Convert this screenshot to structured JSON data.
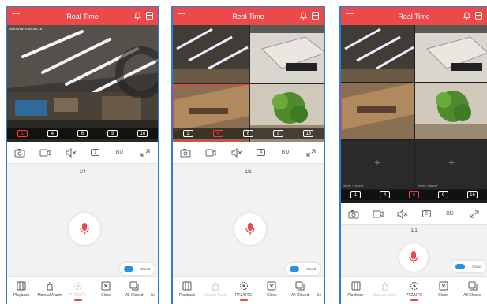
{
  "colors": {
    "accent": "#ec4a4a",
    "frame": "#2a7fd4",
    "cloud": "#2a8fe0"
  },
  "panels": [
    {
      "title": "Real Time",
      "timestamp": "05/01/1970 08:50:19",
      "channels": [
        "1",
        "4",
        "6",
        "9",
        "16"
      ],
      "selected_channel": "1",
      "quality": "BD",
      "page_indicator": "1/4",
      "cloud_label": "Cloud",
      "bottom": [
        "Playback",
        "Manual Alarm",
        "PTZ/UTC",
        "Close",
        "All Closed",
        "Se"
      ]
    },
    {
      "title": "Real Time",
      "channels": [
        "1",
        "4",
        "6",
        "9",
        "16"
      ],
      "selected_channel": "4",
      "quality": "BD",
      "page_indicator": "1/1",
      "cloud_label": "Cloud",
      "bottom": [
        "Playback",
        "Manual Alarm",
        "PTZ/UTC",
        "Close",
        "All Closed",
        "Se"
      ]
    },
    {
      "title": "Real Time",
      "channels": [
        "1",
        "4",
        "6",
        "9",
        "16"
      ],
      "selected_channel": "6",
      "quality": "BD",
      "page_indicator": "1/1",
      "cloud_label": "Cloud",
      "empty_slot_label": "device / channel",
      "bottom": [
        "Playback",
        "Manual Alarm",
        "PTZ/UTC",
        "Close",
        "All Closed"
      ]
    }
  ],
  "icons": [
    "menu-icon",
    "bell-icon",
    "layout-icon",
    "snapshot-icon",
    "record-icon",
    "mute-icon",
    "channel-icon",
    "fullscreen-icon",
    "microphone-icon",
    "cloud-icon",
    "playback-icon",
    "alarm-icon",
    "ptz-icon",
    "close-icon",
    "all-closed-icon"
  ]
}
